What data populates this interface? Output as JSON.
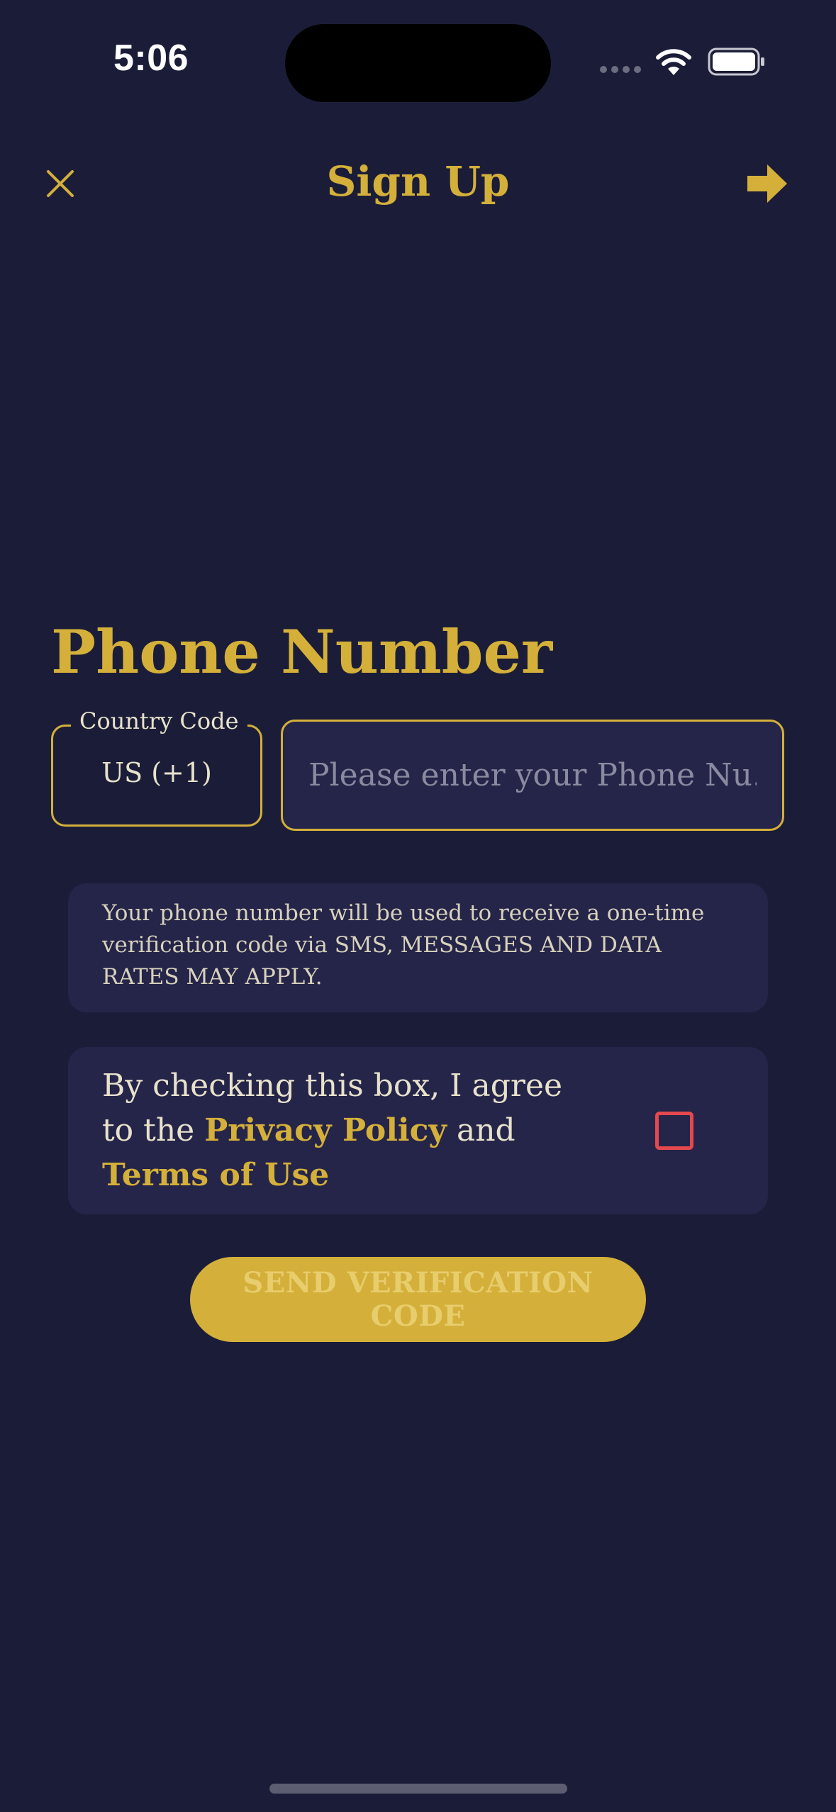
{
  "status_bar": {
    "time": "5:06"
  },
  "header": {
    "title": "Sign Up",
    "close_icon": "close-icon",
    "next_icon": "arrow-right-icon"
  },
  "phone_section": {
    "title": "Phone Number",
    "country_code_label": "Country Code",
    "country_code_value": "US (+1)",
    "phone_placeholder": "Please enter your Phone Nu...",
    "phone_value": ""
  },
  "info": {
    "text": "Your phone number will be used to receive a one-time verification code via SMS, MESSAGES AND DATA RATES MAY APPLY."
  },
  "agreement": {
    "prefix": "By checking this box, I agree to the ",
    "privacy_link": "Privacy Policy",
    "and": " and ",
    "terms_link": "Terms of Use",
    "checked": false
  },
  "actions": {
    "send_label": "SEND VERIFICATION CODE"
  },
  "colors": {
    "background": "#1b1d38",
    "card": "#252449",
    "accent": "#d4b03a",
    "checkbox_border": "#e5484d",
    "text": "#e8e2cc"
  }
}
